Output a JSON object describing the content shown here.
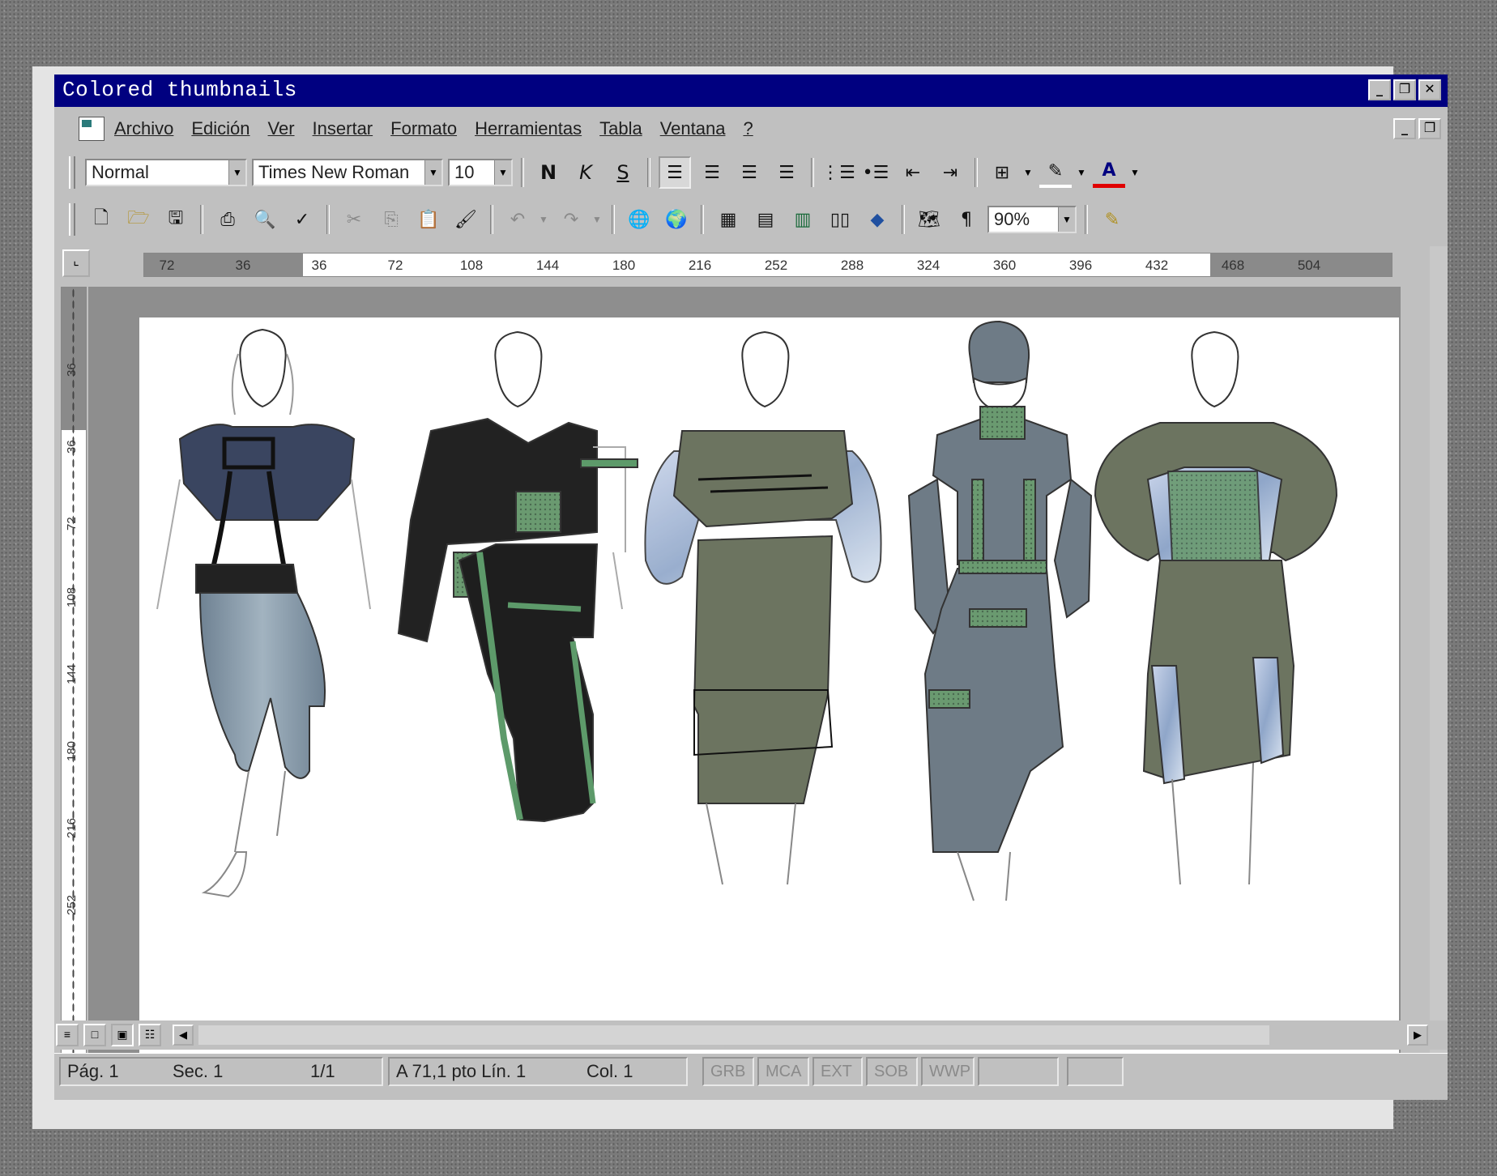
{
  "window": {
    "title": "Colored thumbnails",
    "controls": [
      "_",
      "❐",
      "✕"
    ]
  },
  "menubar": {
    "items": [
      "Archivo",
      "Edición",
      "Ver",
      "Insertar",
      "Formato",
      "Herramientas",
      "Tabla",
      "Ventana",
      "?"
    ],
    "doc_controls": [
      "_",
      "❐"
    ]
  },
  "format_toolbar": {
    "style": "Normal",
    "font": "Times New Roman",
    "size": "10",
    "bold": "N",
    "italic": "K",
    "underline": "S"
  },
  "standard_toolbar": {
    "zoom": "90%"
  },
  "ruler": {
    "horizontal_ticks": [
      "72",
      "36",
      "36",
      "72",
      "108",
      "144",
      "180",
      "216",
      "252",
      "288",
      "324",
      "360",
      "396",
      "432",
      "468",
      "504"
    ],
    "vertical_ticks": [
      "36",
      "36",
      "72",
      "108",
      "144",
      "180",
      "216",
      "252"
    ]
  },
  "statusbar": {
    "page": "Pág. 1",
    "section": "Sec. 1",
    "pages": "1/1",
    "position": "A 71,1 pto Lín. 1",
    "column": "Col. 1",
    "modes": [
      "GRB",
      "MCA",
      "EXT",
      "SOB",
      "WWP"
    ]
  },
  "colors": {
    "titlebar": "#000080",
    "chrome": "#c0c0c0",
    "navy_garment": "#3a4560",
    "denim": "#7f93a3",
    "black_garment": "#222222",
    "olive": "#6c7460",
    "slate": "#6e7b86",
    "green_accent": "#5d9a6a",
    "iridescent": "#b9c6df"
  }
}
